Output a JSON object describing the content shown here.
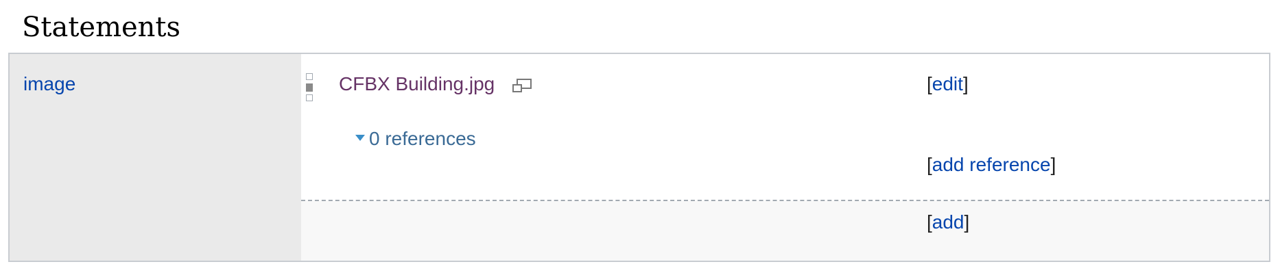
{
  "section": {
    "title": "Statements"
  },
  "statement_group": {
    "property_label": "image",
    "statements": [
      {
        "value_label": "CFBX Building.jpg",
        "value_icon": "media-viewer-icon",
        "rank": "normal",
        "references_toggle": "0 references",
        "toolbar": {
          "open_bracket": "[",
          "close_bracket": "]",
          "edit_label": "edit",
          "add_reference_label": "add reference"
        }
      }
    ],
    "add_toolbar": {
      "open_bracket": "[",
      "close_bracket": "]",
      "add_label": "add"
    }
  },
  "colors": {
    "link": "#0645ad",
    "visited_link": "#663366",
    "toggle": "#3a6a95",
    "property_bg": "#eaeaea",
    "add_row_bg": "#f8f8f8",
    "border": "#c8ccd1"
  }
}
